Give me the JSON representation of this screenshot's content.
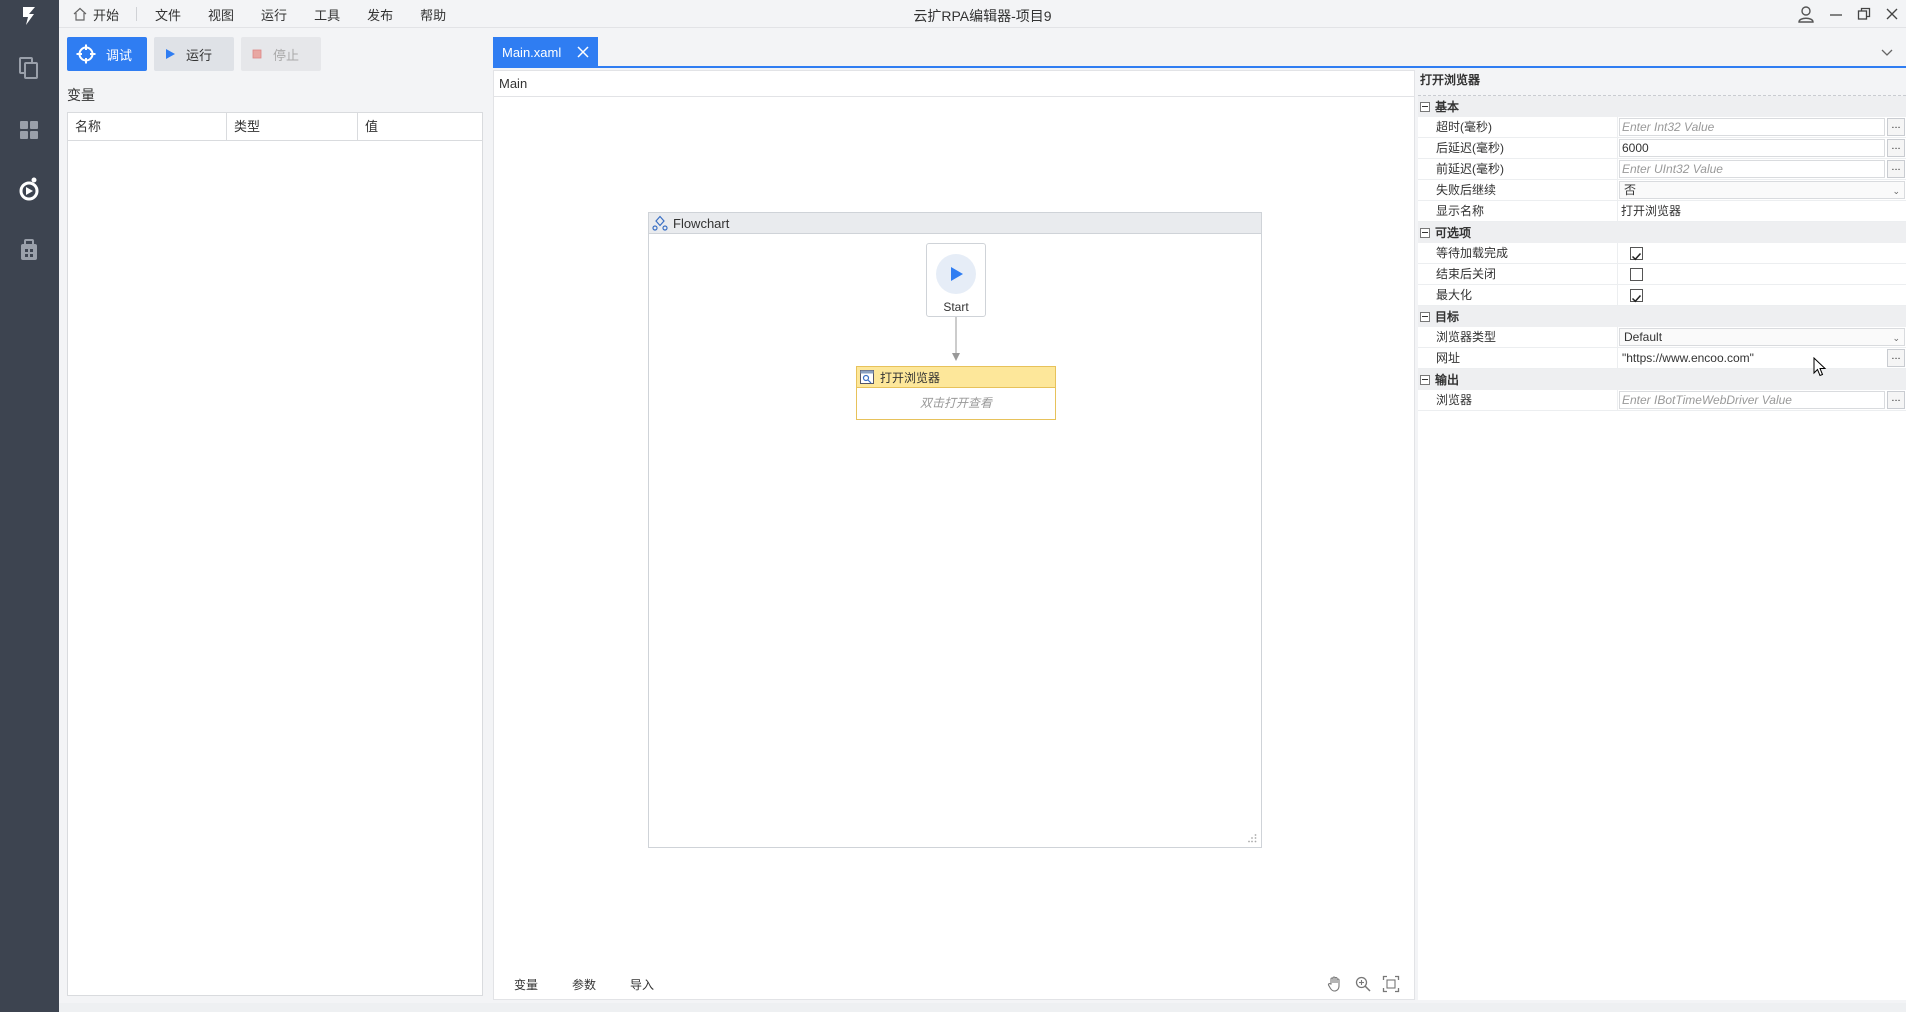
{
  "app": {
    "title": "云扩RPA编辑器-项目9"
  },
  "menu": {
    "items": [
      "开始",
      "文件",
      "视图",
      "运行",
      "工具",
      "发布",
      "帮助"
    ]
  },
  "toolbar": {
    "debug_label": "调试",
    "run_label": "运行",
    "stop_label": "停止"
  },
  "variables": {
    "title": "变量",
    "columns": [
      "名称",
      "类型",
      "值"
    ]
  },
  "editor": {
    "tab_label": "Main.xaml",
    "breadcrumb": "Main",
    "flowchart_title": "Flowchart",
    "start_label": "Start",
    "activity": {
      "title": "打开浏览器",
      "hint": "双击打开查看"
    },
    "bottom_tabs": [
      "变量",
      "参数",
      "导入"
    ]
  },
  "properties": {
    "title": "打开浏览器",
    "categories": {
      "basic": "基本",
      "options": "可选项",
      "target": "目标",
      "output": "输出"
    },
    "rows": {
      "timeout": {
        "name": "超时(毫秒)",
        "placeholder": "Enter Int32 Value"
      },
      "delay_after": {
        "name": "后延迟(毫秒)",
        "value": "6000"
      },
      "delay_before": {
        "name": "前延迟(毫秒)",
        "placeholder": "Enter UInt32 Value"
      },
      "continue_on_error": {
        "name": "失败后继续",
        "value": "否"
      },
      "display_name": {
        "name": "显示名称",
        "value": "打开浏览器"
      },
      "wait_for_load": {
        "name": "等待加载完成",
        "checked": true
      },
      "close_after": {
        "name": "结束后关闭",
        "checked": false
      },
      "maximize": {
        "name": "最大化",
        "checked": true
      },
      "browser_type": {
        "name": "浏览器类型",
        "value": "Default"
      },
      "url": {
        "name": "网址",
        "value": "\"https://www.encoo.com\""
      },
      "browser": {
        "name": "浏览器",
        "placeholder": "Enter IBotTimeWebDriver Value"
      }
    }
  },
  "colors": {
    "accent": "#2f7df2",
    "sidebar": "#3d4450",
    "activity_header": "#fde79a"
  }
}
